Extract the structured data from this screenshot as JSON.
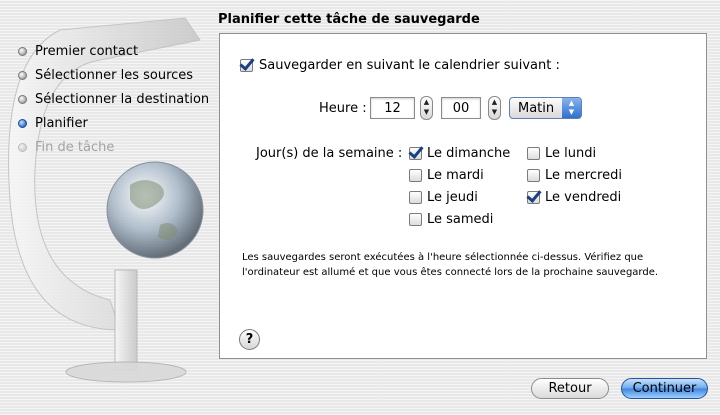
{
  "sidebar": {
    "steps": [
      {
        "label": "Premier contact",
        "state": "done"
      },
      {
        "label": "Sélectionner les sources",
        "state": "done"
      },
      {
        "label": "Sélectionner la destination",
        "state": "done"
      },
      {
        "label": "Planifier",
        "state": "current"
      },
      {
        "label": "Fin de tâche",
        "state": "disabled"
      }
    ]
  },
  "title": "Planifier cette tâche de sauvegarde",
  "schedule": {
    "label": "Sauvegarder en suivant le calendrier suivant :",
    "checked": true
  },
  "time": {
    "label": "Heure :",
    "hour": "12",
    "minute": "00",
    "period": "Matin"
  },
  "days": {
    "label": "Jour(s) de la semaine :",
    "items": [
      {
        "label": "Le dimanche",
        "checked": true
      },
      {
        "label": "Le lundi",
        "checked": false
      },
      {
        "label": "Le mardi",
        "checked": false
      },
      {
        "label": "Le mercredi",
        "checked": false
      },
      {
        "label": "Le jeudi",
        "checked": false
      },
      {
        "label": "Le vendredi",
        "checked": true
      },
      {
        "label": "Le samedi",
        "checked": false
      }
    ]
  },
  "note": {
    "line1": "Les sauvegardes seront exécutées à l'heure sélectionnée ci-dessus. Vérifiez que",
    "line2": "l'ordinateur est allumé et que vous êtes connecté lors de la prochaine sauvegarde."
  },
  "help": {
    "label": "?"
  },
  "buttons": {
    "back": "Retour",
    "continue": "Continuer"
  },
  "colors": {
    "accent": "#3f86dd",
    "check": "#1b3f87"
  }
}
